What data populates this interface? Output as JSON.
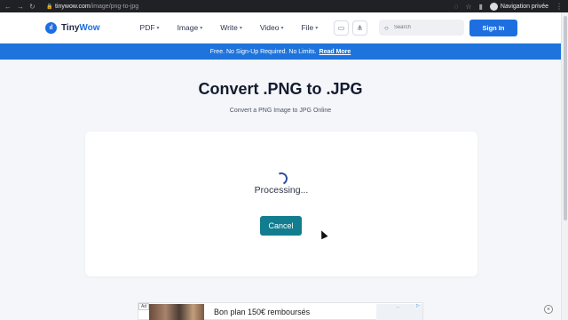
{
  "browser": {
    "url_host": "tinywow.com",
    "url_path": "/image/png-to-jpg",
    "private_label": "Navigation privée"
  },
  "header": {
    "logo_tiny": "Tiny",
    "logo_wow": "Wow",
    "menu": [
      {
        "label": "PDF"
      },
      {
        "label": "Image"
      },
      {
        "label": "Write"
      },
      {
        "label": "Video"
      },
      {
        "label": "File"
      }
    ],
    "search_placeholder": "Search",
    "signin_label": "Sign In"
  },
  "banner": {
    "text": "Free. No Sign-Up Required. No Limits.",
    "link": "Read More"
  },
  "main": {
    "title": "Convert .PNG to .JPG",
    "subtitle": "Convert a PNG Image to JPG Online",
    "status": "Processing...",
    "cancel_label": "Cancel"
  },
  "ad": {
    "tag": "Ad",
    "text": "Bon plan 150€ remboursés"
  },
  "colors": {
    "brand": "#1d6fe0",
    "banner": "#1e73dc",
    "cancel": "#117d8f"
  }
}
